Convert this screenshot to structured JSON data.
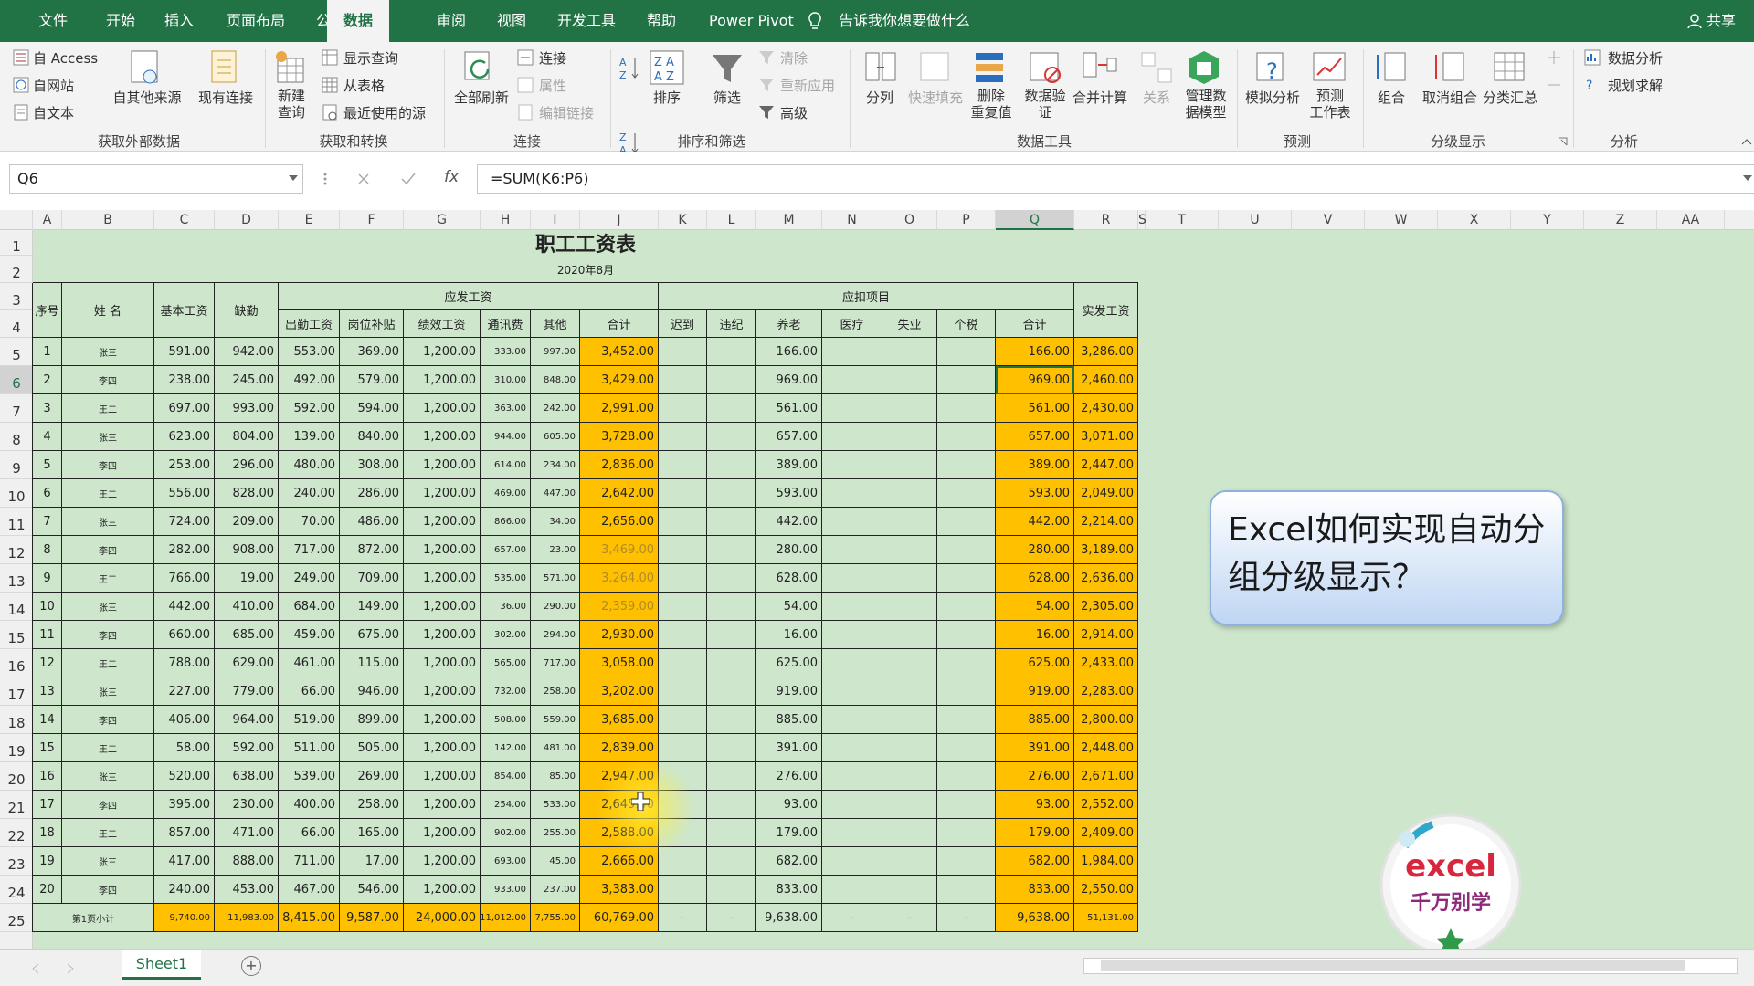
{
  "menu": {
    "tabs": [
      "文件",
      "开始",
      "插入",
      "页面布局",
      "公式",
      "数据",
      "审阅",
      "视图",
      "开发工具",
      "帮助",
      "Power Pivot"
    ],
    "active": "数据",
    "tell_me": "告诉我你想要做什么",
    "share": "共享"
  },
  "ribbon": {
    "get_external": {
      "access": "自 Access",
      "web": "自网站",
      "text": "自文本",
      "other": "自其他来源",
      "existing": "现有连接",
      "label": "获取外部数据"
    },
    "get_transform": {
      "new_query": "新建\n查询",
      "show_queries": "显示查询",
      "from_table": "从表格",
      "recent": "最近使用的源",
      "label": "获取和转换"
    },
    "connections": {
      "refresh_all": "全部刷新",
      "connections": "连接",
      "properties": "属性",
      "edit_links": "编辑链接",
      "label": "连接"
    },
    "sort_filter": {
      "sort": "排序",
      "filter": "筛选",
      "clear": "清除",
      "reapply": "重新应用",
      "advanced": "高级",
      "label": "排序和筛选"
    },
    "data_tools": {
      "text_to_columns": "分列",
      "flash_fill": "快速填充",
      "remove_dup": "删除\n重复值",
      "validation": "数据验\n证",
      "consolidate": "合并计算",
      "relationships": "关系",
      "manage_model": "管理数\n据模型",
      "label": "数据工具"
    },
    "forecast": {
      "what_if": "模拟分析",
      "forecast_sheet": "预测\n工作表",
      "label": "预测"
    },
    "outline": {
      "group": "组合",
      "ungroup": "取消组合",
      "subtotal": "分类汇总",
      "label": "分级显示"
    },
    "analysis": {
      "data_analysis": "数据分析",
      "solver": "规划求解",
      "label": "分析"
    }
  },
  "formula_bar": {
    "name_box": "Q6",
    "formula": "=SUM(K6:P6)",
    "fx": "fx"
  },
  "columns": [
    "A",
    "B",
    "C",
    "D",
    "E",
    "F",
    "G",
    "H",
    "I",
    "J",
    "K",
    "L",
    "M",
    "N",
    "O",
    "P",
    "Q",
    "R",
    "S",
    "T",
    "U",
    "V",
    "W",
    "X",
    "Y",
    "Z",
    "AA"
  ],
  "selected_column": "Q",
  "rows": [
    "1",
    "2",
    "3",
    "4",
    "5",
    "6",
    "7",
    "8",
    "9",
    "10",
    "11",
    "12",
    "13",
    "14",
    "15",
    "16",
    "17",
    "18",
    "19",
    "20",
    "21",
    "22",
    "23",
    "24",
    "25"
  ],
  "selected_row": "6",
  "sheet": {
    "title": "职工工资表",
    "subtitle": "2020年8月",
    "headers": {
      "seq": "序号",
      "name": "姓 名",
      "base": "基本工资",
      "absent": "缺勤",
      "payable": "应发工资",
      "attendance": "出勤工资",
      "post": "岗位补贴",
      "perf": "绩效工资",
      "comm": "通讯费",
      "other": "其他",
      "pay_total": "合计",
      "deduct": "应扣项目",
      "late": "迟到",
      "violation": "违纪",
      "pension": "养老",
      "medical": "医疗",
      "unemploy": "失业",
      "tax": "个税",
      "ded_total": "合计",
      "net": "实发工资"
    },
    "data": [
      [
        "1",
        "张三",
        "591.00",
        "942.00",
        "553.00",
        "369.00",
        "1,200.00",
        "333.00",
        "997.00",
        "3,452.00",
        "",
        "",
        "166.00",
        "",
        "",
        "",
        "166.00",
        "3,286.00"
      ],
      [
        "2",
        "李四",
        "238.00",
        "245.00",
        "492.00",
        "579.00",
        "1,200.00",
        "310.00",
        "848.00",
        "3,429.00",
        "",
        "",
        "969.00",
        "",
        "",
        "",
        "969.00",
        "2,460.00"
      ],
      [
        "3",
        "王二",
        "697.00",
        "993.00",
        "592.00",
        "594.00",
        "1,200.00",
        "363.00",
        "242.00",
        "2,991.00",
        "",
        "",
        "561.00",
        "",
        "",
        "",
        "561.00",
        "2,430.00"
      ],
      [
        "4",
        "张三",
        "623.00",
        "804.00",
        "139.00",
        "840.00",
        "1,200.00",
        "944.00",
        "605.00",
        "3,728.00",
        "",
        "",
        "657.00",
        "",
        "",
        "",
        "657.00",
        "3,071.00"
      ],
      [
        "5",
        "李四",
        "253.00",
        "296.00",
        "480.00",
        "308.00",
        "1,200.00",
        "614.00",
        "234.00",
        "2,836.00",
        "",
        "",
        "389.00",
        "",
        "",
        "",
        "389.00",
        "2,447.00"
      ],
      [
        "6",
        "王二",
        "556.00",
        "828.00",
        "240.00",
        "286.00",
        "1,200.00",
        "469.00",
        "447.00",
        "2,642.00",
        "",
        "",
        "593.00",
        "",
        "",
        "",
        "593.00",
        "2,049.00"
      ],
      [
        "7",
        "张三",
        "724.00",
        "209.00",
        "70.00",
        "486.00",
        "1,200.00",
        "866.00",
        "34.00",
        "2,656.00",
        "",
        "",
        "442.00",
        "",
        "",
        "",
        "442.00",
        "2,214.00"
      ],
      [
        "8",
        "李四",
        "282.00",
        "908.00",
        "717.00",
        "872.00",
        "1,200.00",
        "657.00",
        "23.00",
        "3,469.00",
        "",
        "",
        "280.00",
        "",
        "",
        "",
        "280.00",
        "3,189.00"
      ],
      [
        "9",
        "王二",
        "766.00",
        "19.00",
        "249.00",
        "709.00",
        "1,200.00",
        "535.00",
        "571.00",
        "3,264.00",
        "",
        "",
        "628.00",
        "",
        "",
        "",
        "628.00",
        "2,636.00"
      ],
      [
        "10",
        "张三",
        "442.00",
        "410.00",
        "684.00",
        "149.00",
        "1,200.00",
        "36.00",
        "290.00",
        "2,359.00",
        "",
        "",
        "54.00",
        "",
        "",
        "",
        "54.00",
        "2,305.00"
      ],
      [
        "11",
        "李四",
        "660.00",
        "685.00",
        "459.00",
        "675.00",
        "1,200.00",
        "302.00",
        "294.00",
        "2,930.00",
        "",
        "",
        "16.00",
        "",
        "",
        "",
        "16.00",
        "2,914.00"
      ],
      [
        "12",
        "王二",
        "788.00",
        "629.00",
        "461.00",
        "115.00",
        "1,200.00",
        "565.00",
        "717.00",
        "3,058.00",
        "",
        "",
        "625.00",
        "",
        "",
        "",
        "625.00",
        "2,433.00"
      ],
      [
        "13",
        "张三",
        "227.00",
        "779.00",
        "66.00",
        "946.00",
        "1,200.00",
        "732.00",
        "258.00",
        "3,202.00",
        "",
        "",
        "919.00",
        "",
        "",
        "",
        "919.00",
        "2,283.00"
      ],
      [
        "14",
        "李四",
        "406.00",
        "964.00",
        "519.00",
        "899.00",
        "1,200.00",
        "508.00",
        "559.00",
        "3,685.00",
        "",
        "",
        "885.00",
        "",
        "",
        "",
        "885.00",
        "2,800.00"
      ],
      [
        "15",
        "王二",
        "58.00",
        "592.00",
        "511.00",
        "505.00",
        "1,200.00",
        "142.00",
        "481.00",
        "2,839.00",
        "",
        "",
        "391.00",
        "",
        "",
        "",
        "391.00",
        "2,448.00"
      ],
      [
        "16",
        "张三",
        "520.00",
        "638.00",
        "539.00",
        "269.00",
        "1,200.00",
        "854.00",
        "85.00",
        "2,947.00",
        "",
        "",
        "276.00",
        "",
        "",
        "",
        "276.00",
        "2,671.00"
      ],
      [
        "17",
        "李四",
        "395.00",
        "230.00",
        "400.00",
        "258.00",
        "1,200.00",
        "254.00",
        "533.00",
        "2,645.00",
        "",
        "",
        "93.00",
        "",
        "",
        "",
        "93.00",
        "2,552.00"
      ],
      [
        "18",
        "王二",
        "857.00",
        "471.00",
        "66.00",
        "165.00",
        "1,200.00",
        "902.00",
        "255.00",
        "2,588.00",
        "",
        "",
        "179.00",
        "",
        "",
        "",
        "179.00",
        "2,409.00"
      ],
      [
        "19",
        "张三",
        "417.00",
        "888.00",
        "711.00",
        "17.00",
        "1,200.00",
        "693.00",
        "45.00",
        "2,666.00",
        "",
        "",
        "682.00",
        "",
        "",
        "",
        "682.00",
        "1,984.00"
      ],
      [
        "20",
        "李四",
        "240.00",
        "453.00",
        "467.00",
        "546.00",
        "1,200.00",
        "933.00",
        "237.00",
        "3,383.00",
        "",
        "",
        "833.00",
        "",
        "",
        "",
        "833.00",
        "2,550.00"
      ]
    ],
    "subtotal": [
      "第1页小计",
      "9,740.00",
      "11,983.00",
      "8,415.00",
      "9,587.00",
      "24,000.00",
      "11,012.00",
      "7,755.00",
      "60,769.00",
      "-",
      "-",
      "9,638.00",
      "-",
      "-",
      "-",
      "9,638.00",
      "51,131.00"
    ]
  },
  "overlay": {
    "bubble_text": "Excel如何实现自动分组分级显示？",
    "logo_top": "excel",
    "logo_bottom": "千万别学"
  },
  "tabs": {
    "sheet": "Sheet1",
    "add": "+"
  }
}
